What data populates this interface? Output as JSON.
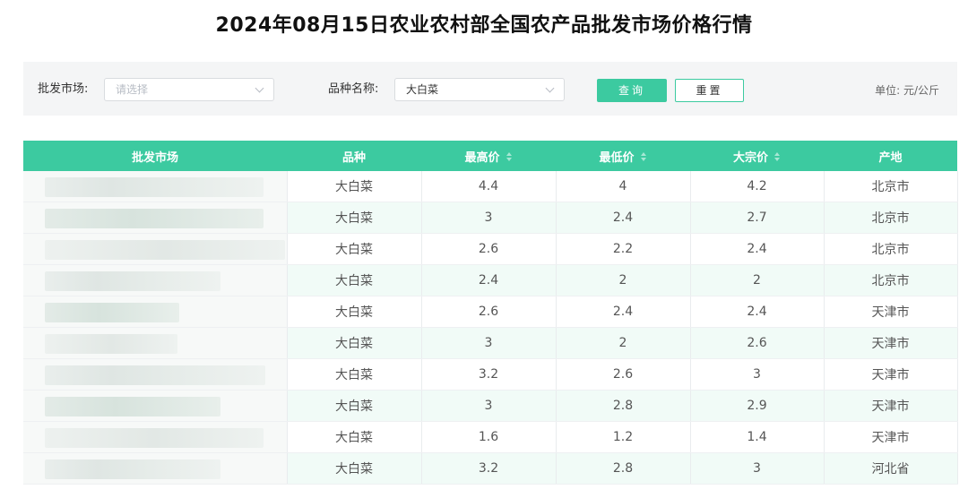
{
  "page": {
    "title": "2024年08月15日农业农村部全国农产品批发市场价格行情"
  },
  "filters": {
    "market_label": "批发市场:",
    "market_placeholder": "请选择",
    "variety_label": "品种名称:",
    "variety_value": "大白菜",
    "query_button": "查询",
    "reset_button": "重置",
    "unit": "单位: 元/公斤"
  },
  "colors": {
    "accent": "#3ccaa0",
    "row_alt": "#f1fbf7"
  },
  "icons": {
    "select_arrow": "chevron-down-icon",
    "sort": "sort-icon"
  },
  "table": {
    "headers": {
      "market": "批发市场",
      "variety": "品种",
      "max_price": "最高价",
      "min_price": "最低价",
      "bulk_price": "大宗价",
      "origin": "产地"
    },
    "rows": [
      {
        "variety": "大白菜",
        "max": "4.4",
        "min": "4",
        "bulk": "4.2",
        "origin": "北京市"
      },
      {
        "variety": "大白菜",
        "max": "3",
        "min": "2.4",
        "bulk": "2.7",
        "origin": "北京市"
      },
      {
        "variety": "大白菜",
        "max": "2.6",
        "min": "2.2",
        "bulk": "2.4",
        "origin": "北京市"
      },
      {
        "variety": "大白菜",
        "max": "2.4",
        "min": "2",
        "bulk": "2",
        "origin": "北京市"
      },
      {
        "variety": "大白菜",
        "max": "2.6",
        "min": "2.4",
        "bulk": "2.4",
        "origin": "天津市"
      },
      {
        "variety": "大白菜",
        "max": "3",
        "min": "2",
        "bulk": "2.6",
        "origin": "天津市"
      },
      {
        "variety": "大白菜",
        "max": "3.2",
        "min": "2.6",
        "bulk": "3",
        "origin": "天津市"
      },
      {
        "variety": "大白菜",
        "max": "3",
        "min": "2.8",
        "bulk": "2.9",
        "origin": "天津市"
      },
      {
        "variety": "大白菜",
        "max": "1.6",
        "min": "1.2",
        "bulk": "1.4",
        "origin": "天津市"
      },
      {
        "variety": "大白菜",
        "max": "3.2",
        "min": "2.8",
        "bulk": "3",
        "origin": "河北省"
      }
    ]
  }
}
